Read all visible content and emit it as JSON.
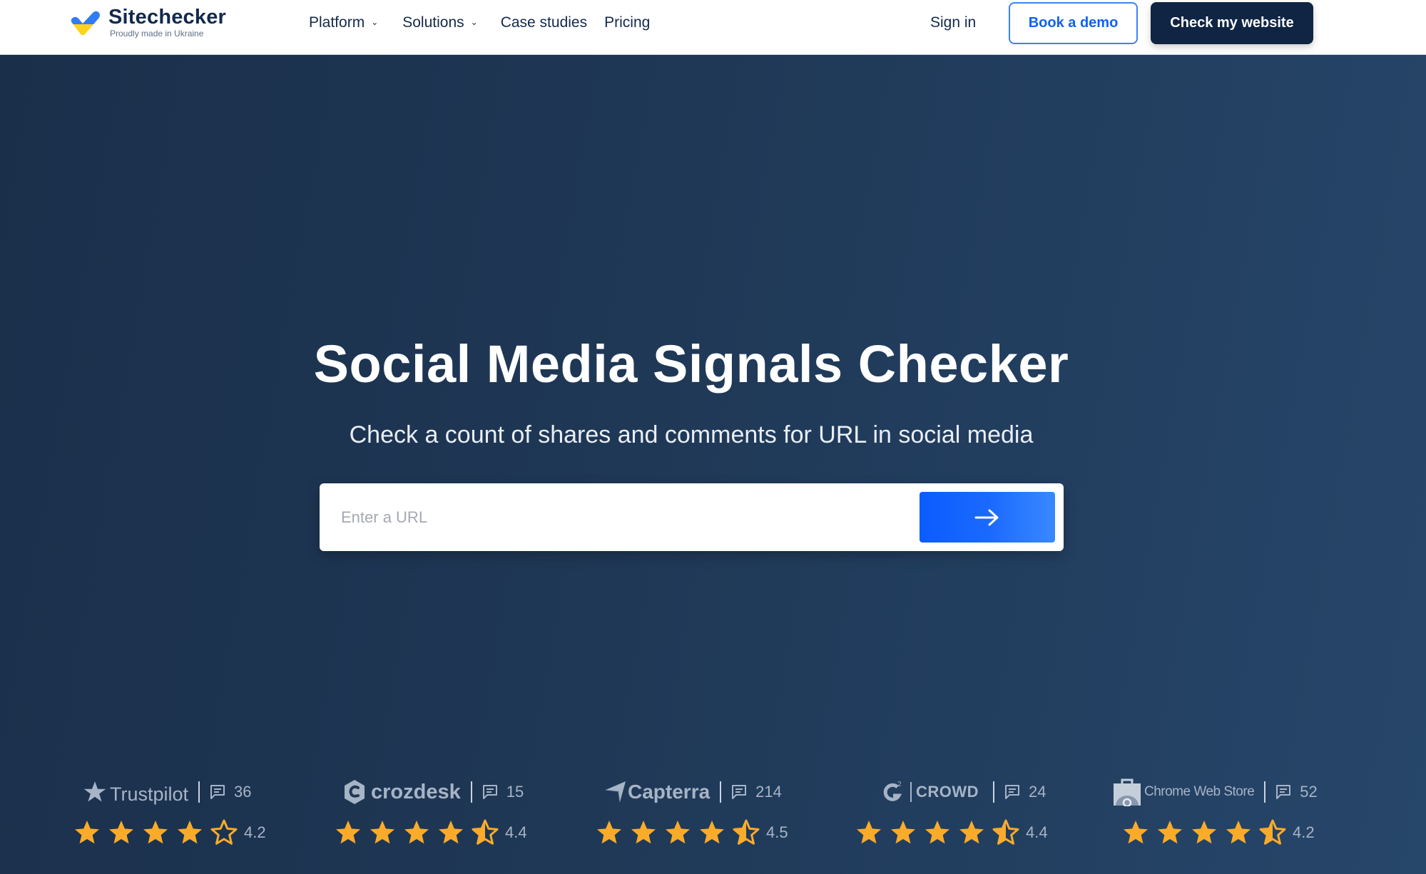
{
  "header": {
    "logo": {
      "name": "Sitechecker",
      "tagline": "Proudly made in Ukraine",
      "colors": {
        "blue": "#2f7cf6",
        "yellow": "#ffd21f"
      }
    },
    "nav": [
      {
        "label": "Platform",
        "has_dropdown": true
      },
      {
        "label": "Solutions",
        "has_dropdown": true
      },
      {
        "label": "Case studies",
        "has_dropdown": false
      },
      {
        "label": "Pricing",
        "has_dropdown": false
      }
    ],
    "sign_in": "Sign in",
    "book_demo": "Book a demo",
    "check_website": "Check my website"
  },
  "hero": {
    "title": "Social Media Signals Checker",
    "subtitle": "Check a count of shares and comments for URL in social media",
    "search": {
      "placeholder": "Enter a URL",
      "value": "",
      "submit_icon": "arrow-right-icon"
    }
  },
  "ratings": [
    {
      "platform": "Trustpilot",
      "reviews": "36",
      "score": "4.2",
      "stars": [
        1,
        1,
        1,
        1,
        0
      ]
    },
    {
      "platform": "crozdesk",
      "reviews": "15",
      "score": "4.4",
      "stars": [
        1,
        1,
        1,
        1,
        0.5
      ]
    },
    {
      "platform": "Capterra",
      "reviews": "214",
      "score": "4.5",
      "stars": [
        1,
        1,
        1,
        1,
        0.5
      ]
    },
    {
      "platform": "CROWD",
      "reviews": "24",
      "score": "4.4",
      "stars": [
        1,
        1,
        1,
        1,
        0.5
      ]
    },
    {
      "platform": "Chrome Web Store",
      "reviews": "52",
      "score": "4.2",
      "stars": [
        1,
        1,
        1,
        1,
        0.5
      ]
    }
  ],
  "colors": {
    "accent": "#0d62f2",
    "navy": "#0f2543",
    "star": "#fbab2a",
    "rating_text": "#a7b4c6"
  }
}
